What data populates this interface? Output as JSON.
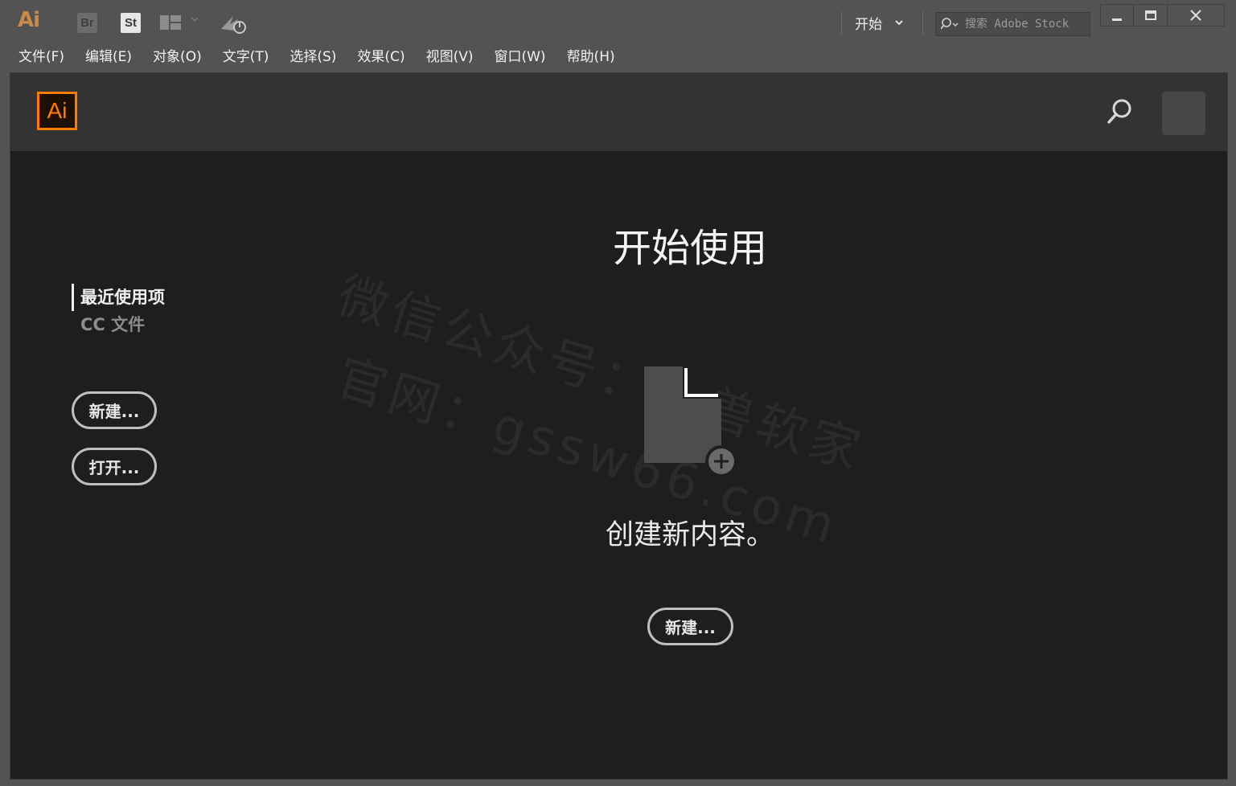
{
  "titlebar": {
    "app_abbr": "Ai",
    "bridge_label": "Br",
    "stock_label": "St",
    "workspace_label": "开始",
    "stock_search_placeholder": "搜索 Adobe Stock"
  },
  "menu": [
    "文件(F)",
    "编辑(E)",
    "对象(O)",
    "文字(T)",
    "选择(S)",
    "效果(C)",
    "视图(V)",
    "窗口(W)",
    "帮助(H)"
  ],
  "start": {
    "logo_label": "Ai",
    "title": "开始使用",
    "nav": [
      "最近使用项",
      "CC 文件"
    ],
    "new_label": "新建...",
    "open_label": "打开...",
    "create_text": "创建新内容。",
    "center_new_label": "新建..."
  },
  "watermark": {
    "line1": "微信公众号：怪兽软家",
    "line2": "官网：gssw66.com"
  },
  "icons": [
    "search-icon",
    "doc-add-icon",
    "sync-icon",
    "layout-icon",
    "minimize-icon",
    "maximize-icon",
    "close-icon"
  ],
  "colors": {
    "accent": "#ff7c00",
    "panel_bg": "#1e1e1e",
    "header_bg": "#333333",
    "chrome_bg": "#535353"
  }
}
